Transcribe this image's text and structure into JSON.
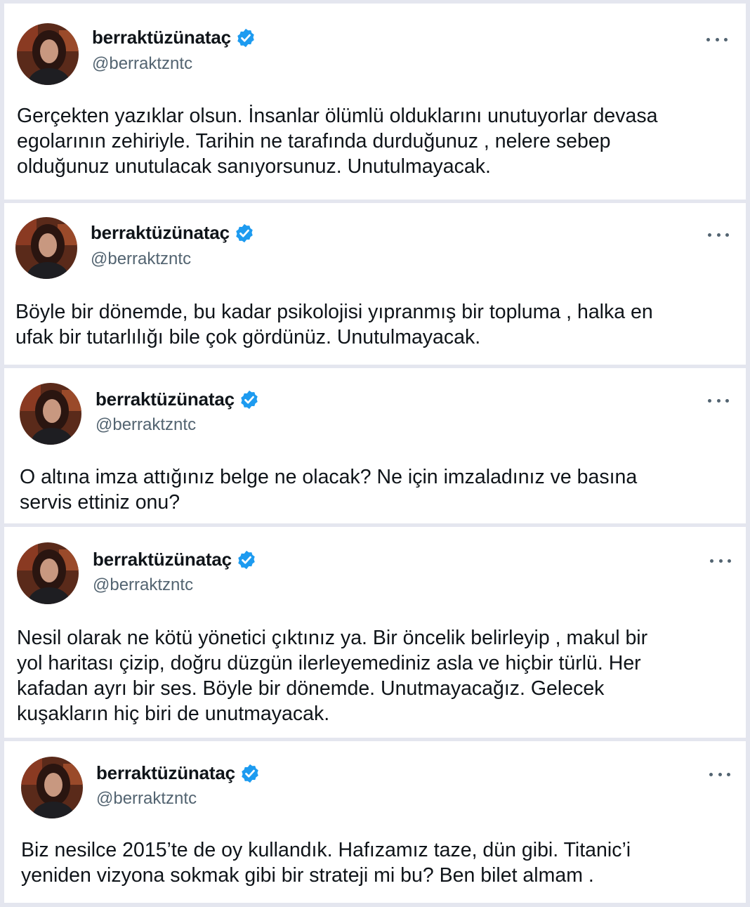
{
  "colors": {
    "background": "#e4e6ef",
    "card": "#ffffff",
    "text": "#0f1419",
    "secondary": "#536471",
    "verified": "#1d9bf0"
  },
  "icons": {
    "verified": "verified-badge-icon",
    "more": "more-options-icon"
  },
  "tweets": [
    {
      "name": "berraktüzünataç",
      "handle": "@berraktzntc",
      "lines": [
        "Gerçekten yazıklar olsun. İnsanlar ölümlü olduklarını unutuyorlar devasa",
        "egolarının zehiriyle. Tarihin ne tarafında durduğunuz , nelere sebep",
        "olduğunuz unutulacak sanıyorsunuz. Unutulmayacak."
      ]
    },
    {
      "name": "berraktüzünataç",
      "handle": "@berraktzntc",
      "lines": [
        "Böyle bir dönemde, bu kadar psikolojisi yıpranmış bir topluma , halka en",
        "ufak bir tutarlılığı bile çok gördünüz. Unutulmayacak."
      ]
    },
    {
      "name": "berraktüzünataç",
      "handle": "@berraktzntc",
      "lines": [
        "O altına imza attığınız belge ne olacak? Ne için imzaladınız ve basına",
        "servis ettiniz onu?"
      ]
    },
    {
      "name": "berraktüzünataç",
      "handle": "@berraktzntc",
      "lines": [
        "Nesil olarak ne kötü yönetici çıktınız ya. Bir öncelik belirleyip , makul bir",
        "yol haritası çizip, doğru düzgün ilerleyemediniz asla ve hiçbir türlü. Her",
        "kafadan ayrı bir ses. Böyle bir dönemde. Unutmayacağız. Gelecek",
        "kuşakların hiç biri de unutmayacak."
      ]
    },
    {
      "name": "berraktüzünataç",
      "handle": "@berraktzntc",
      "lines": [
        "Biz nesilce 2015’te de oy kullandık. Hafızamız taze, dün gibi. Titanic’i",
        "yeniden vizyona sokmak gibi bir strateji mi bu? Ben bilet almam ."
      ]
    }
  ]
}
